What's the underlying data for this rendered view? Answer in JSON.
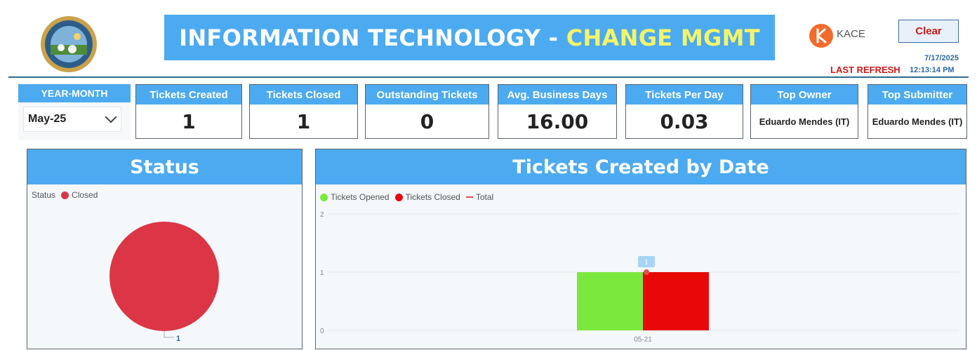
{
  "header": {
    "title_main": "INFORMATION TECHNOLOGY - ",
    "title_accent": "CHANGE MGMT",
    "kace_label": "KACE",
    "clear_label": "Clear",
    "refresh_date": "7/17/2025",
    "refresh_label": "LAST REFRESH",
    "refresh_time": "12:13:14 PM"
  },
  "slicer": {
    "title": "YEAR-MONTH",
    "selected": "May-25"
  },
  "kpis": [
    {
      "label": "Tickets Created",
      "value": "1"
    },
    {
      "label": "Tickets Closed",
      "value": "1"
    },
    {
      "label": "Outstanding Tickets",
      "value": "0"
    },
    {
      "label": "Avg. Business Days",
      "value": "16.00"
    },
    {
      "label": "Tickets Per Day",
      "value": "0.03"
    },
    {
      "label": "Top Owner",
      "value": "Eduardo Mendes (IT)"
    },
    {
      "label": "Top Submitter",
      "value": "Eduardo Mendes (IT)"
    }
  ],
  "status_panel": {
    "title": "Status",
    "legend_title": "Status",
    "legend_item": "Closed",
    "slice_label": "1"
  },
  "tickets_panel": {
    "title": "Tickets Created by Date",
    "legend": [
      "Tickets Opened",
      "Tickets Closed",
      "Total"
    ]
  },
  "colors": {
    "accent": "#4caaf0",
    "opened": "#7be83e",
    "closed": "#e80808",
    "status_closed": "#dc3545",
    "total_line": "#e0524f"
  },
  "chart_data": [
    {
      "type": "pie",
      "categories": [
        "Closed"
      ],
      "values": [
        1
      ],
      "legend_title": "Status",
      "data_labels": [
        "1"
      ],
      "legend": "top-left"
    },
    {
      "type": "bar",
      "categories": [
        "05-21"
      ],
      "series": [
        {
          "name": "Tickets Opened",
          "values": [
            1
          ]
        },
        {
          "name": "Tickets Closed",
          "values": [
            1
          ]
        },
        {
          "name": "Total",
          "values": [
            1
          ]
        }
      ],
      "ylim": [
        0,
        2
      ],
      "yticks": [
        0,
        1,
        2
      ],
      "data_labels": [
        "1"
      ],
      "grid": true,
      "legend": "top-left"
    }
  ]
}
